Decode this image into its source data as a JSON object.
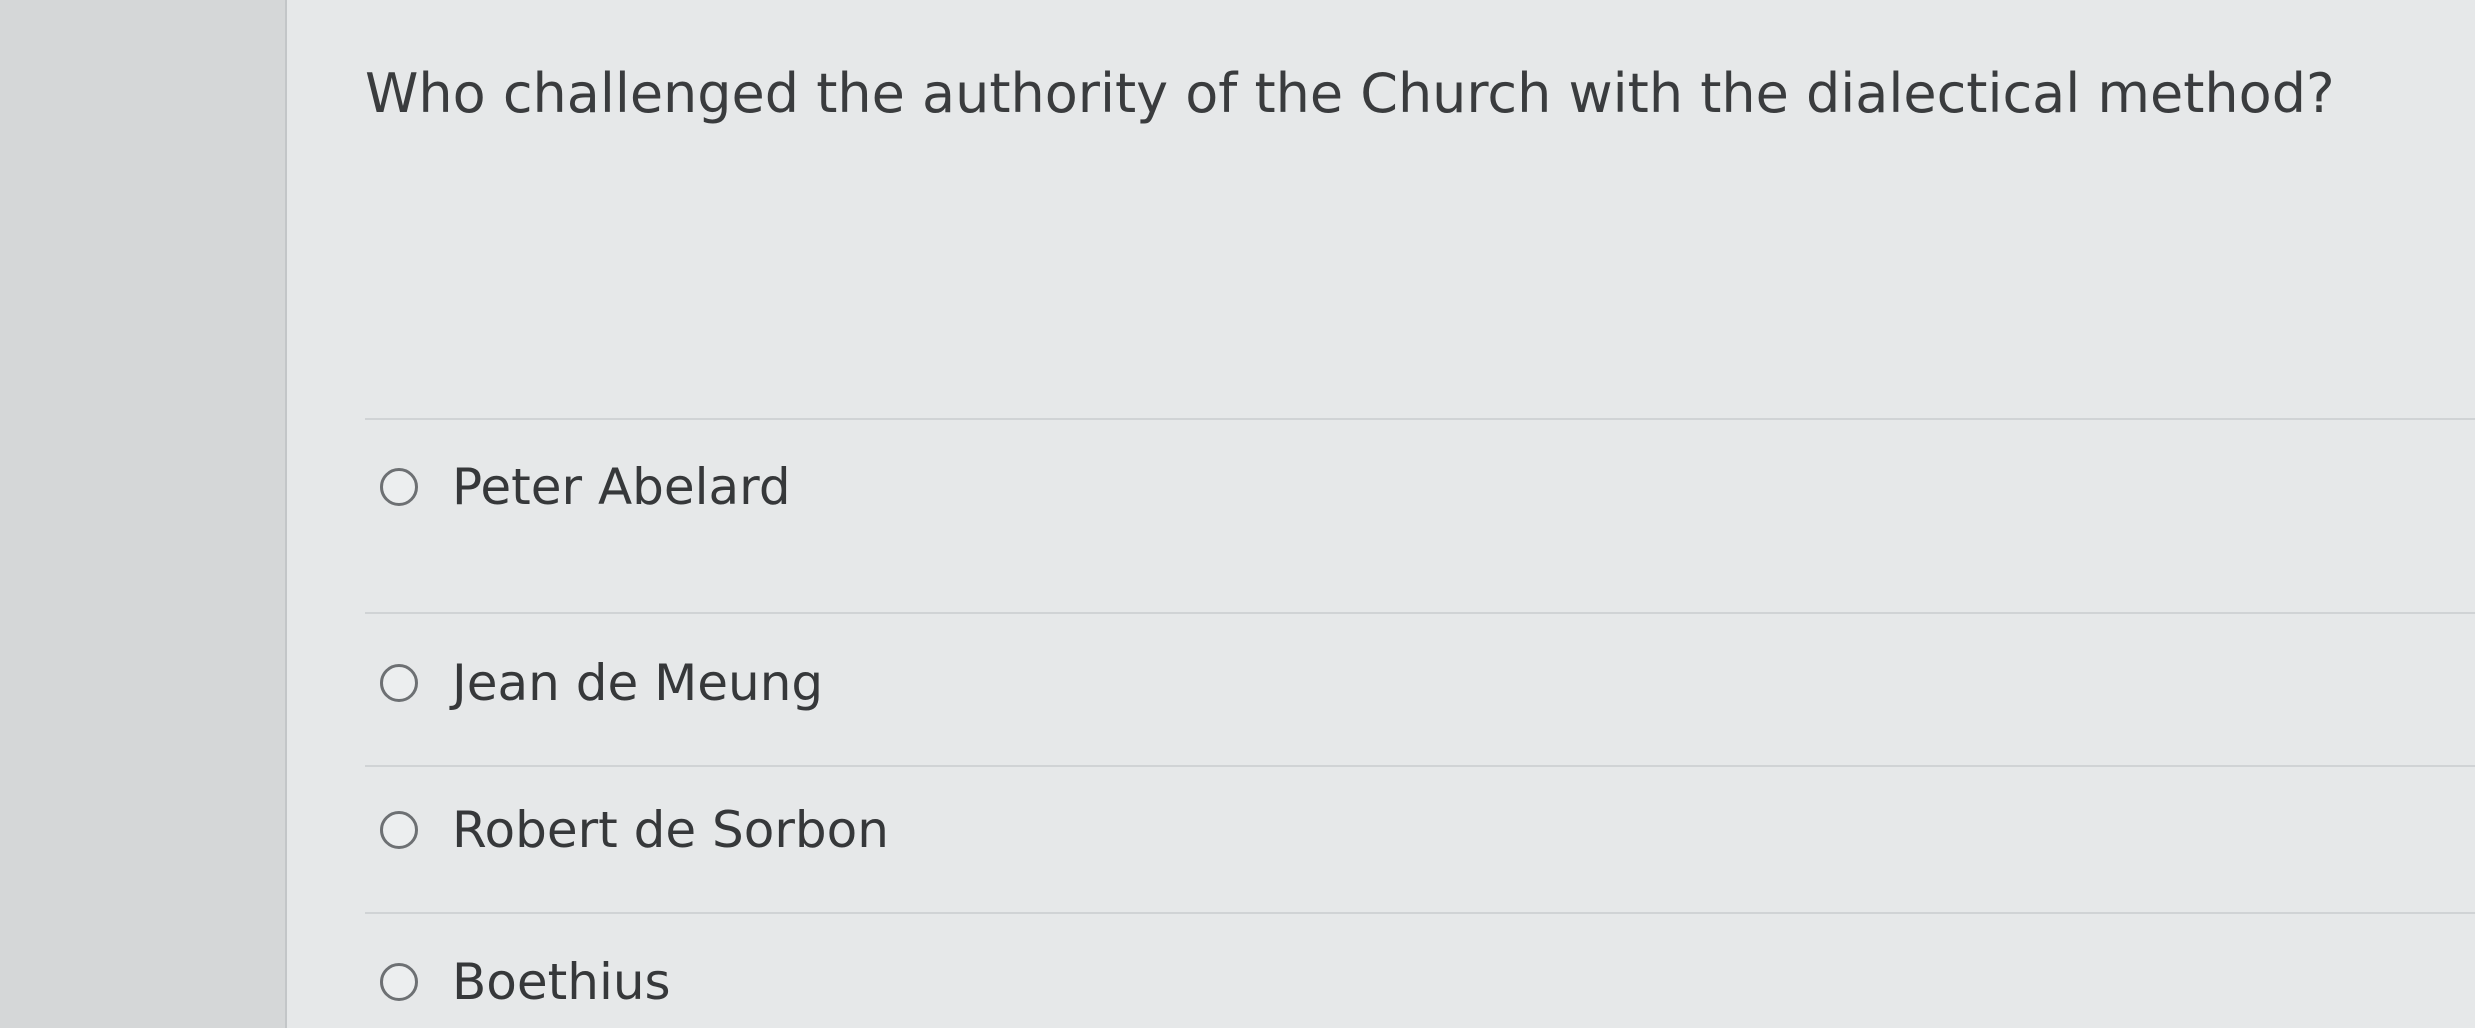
{
  "quiz": {
    "question": "Who challenged the authority of the Church with the dialectical method?",
    "options": [
      {
        "label": "Peter Abelard"
      },
      {
        "label": "Jean de Meung"
      },
      {
        "label": "Robert de Sorbon"
      },
      {
        "label": "Boethius"
      }
    ]
  }
}
